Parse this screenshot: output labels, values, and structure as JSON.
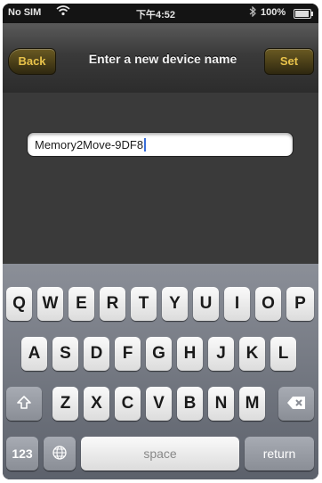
{
  "status_bar": {
    "carrier": "No SIM",
    "wifi_icon": "wifi-icon",
    "time": "下午4:52",
    "bluetooth_icon": "bluetooth-icon",
    "battery": "100%"
  },
  "nav": {
    "back_label": "Back",
    "title": "Enter a new device name",
    "set_label": "Set"
  },
  "name_field": {
    "value": "Memory2Move-9DF8"
  },
  "keyboard": {
    "row1": [
      "Q",
      "W",
      "E",
      "R",
      "T",
      "Y",
      "U",
      "I",
      "O",
      "P"
    ],
    "row2": [
      "A",
      "S",
      "D",
      "F",
      "G",
      "H",
      "J",
      "K",
      "L"
    ],
    "row3": [
      "Z",
      "X",
      "C",
      "V",
      "B",
      "N",
      "M"
    ],
    "shift_icon": "shift-icon",
    "delete_icon": "delete-icon",
    "numbers_label": "123",
    "globe_icon": "globe-icon",
    "space_label": "space",
    "return_label": "return"
  },
  "colors": {
    "nav_button_text": "#e8c24a",
    "caret": "#3a6ed8"
  }
}
